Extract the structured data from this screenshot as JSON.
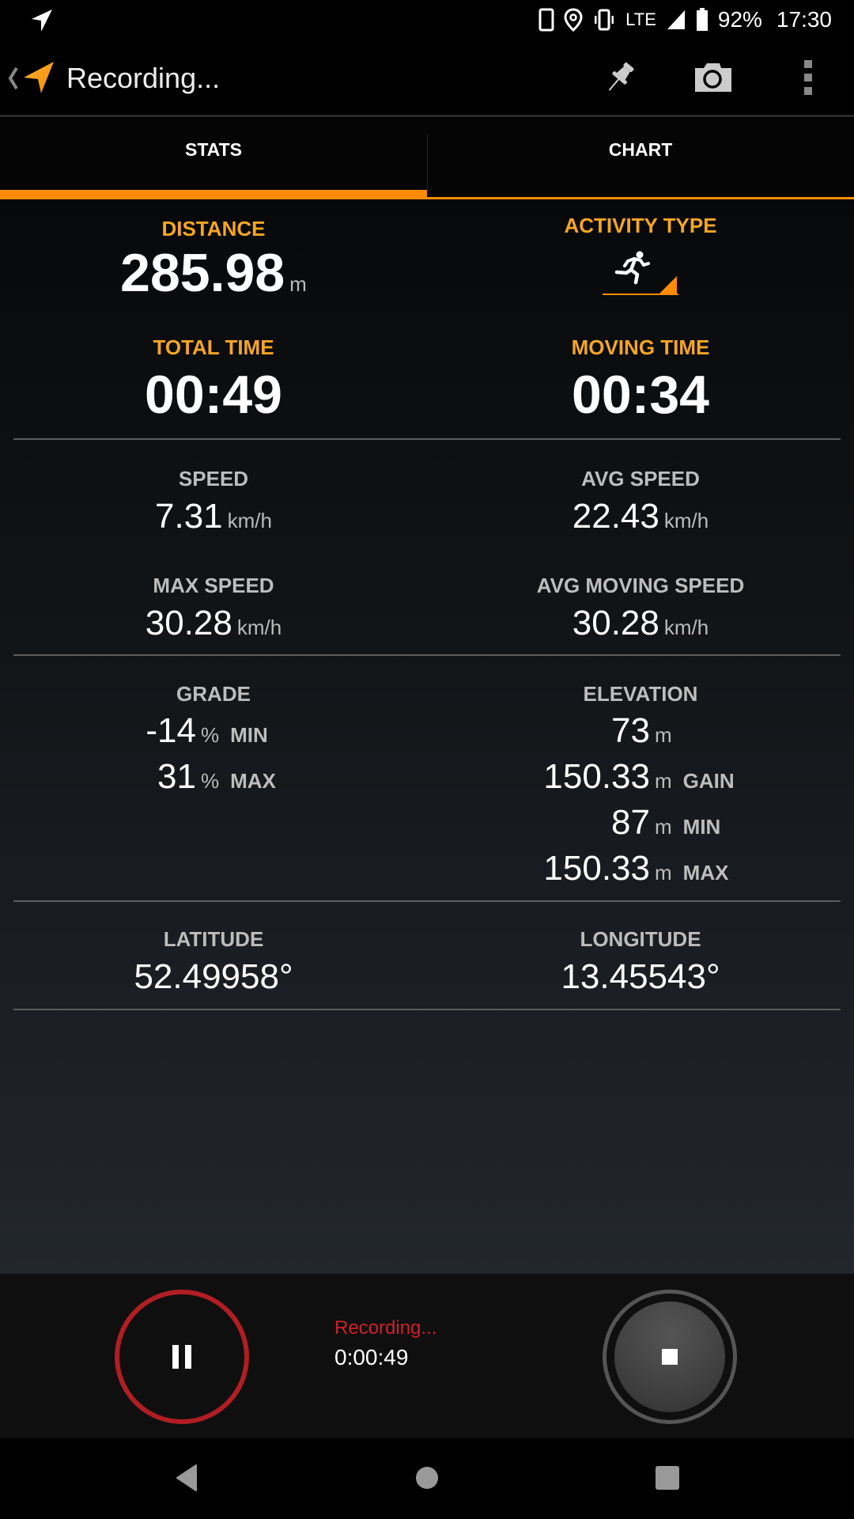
{
  "status_bar": {
    "battery": "92%",
    "time": "17:30",
    "network": "LTE",
    "icons": [
      "navigation-arrow-icon",
      "phone-icon",
      "location-pin-icon",
      "vibrate-icon",
      "signal-icon",
      "battery-icon"
    ]
  },
  "action_bar": {
    "title": "Recording...",
    "actions": [
      "pin-icon",
      "camera-icon",
      "overflow-menu-icon"
    ]
  },
  "tabs": [
    {
      "label": "STATS",
      "active": true
    },
    {
      "label": "CHART",
      "active": false
    }
  ],
  "stats": {
    "distance": {
      "label": "DISTANCE",
      "value": "285.98",
      "unit": "m"
    },
    "activity_type": {
      "label": "ACTIVITY TYPE",
      "icon": "running-icon"
    },
    "total_time": {
      "label": "TOTAL TIME",
      "value": "00:49"
    },
    "moving_time": {
      "label": "MOVING TIME",
      "value": "00:34"
    },
    "speed": {
      "label": "SPEED",
      "value": "7.31",
      "unit": "km/h"
    },
    "avg_speed": {
      "label": "AVG SPEED",
      "value": "22.43",
      "unit": "km/h"
    },
    "max_speed": {
      "label": "MAX SPEED",
      "value": "30.28",
      "unit": "km/h"
    },
    "avg_moving_speed": {
      "label": "AVG MOVING SPEED",
      "value": "30.28",
      "unit": "km/h"
    },
    "grade": {
      "label": "GRADE",
      "rows": [
        {
          "value": "-14",
          "unit": "%",
          "tag": "MIN"
        },
        {
          "value": "31",
          "unit": "%",
          "tag": "MAX"
        }
      ]
    },
    "elevation": {
      "label": "ELEVATION",
      "rows": [
        {
          "value": "73",
          "unit": "m",
          "tag": ""
        },
        {
          "value": "150.33",
          "unit": "m",
          "tag": "GAIN"
        },
        {
          "value": "87",
          "unit": "m",
          "tag": "MIN"
        },
        {
          "value": "150.33",
          "unit": "m",
          "tag": "MAX"
        }
      ]
    },
    "latitude": {
      "label": "LATITUDE",
      "value": "52.49958°"
    },
    "longitude": {
      "label": "LONGITUDE",
      "value": "13.45543°"
    }
  },
  "controls": {
    "status": "Recording...",
    "elapsed": "0:00:49",
    "pause_icon": "pause-icon",
    "stop_icon": "stop-icon"
  },
  "colors": {
    "accent": "#ff8c00",
    "label_orange": "#f5a623",
    "recording_red": "#b01e23"
  }
}
